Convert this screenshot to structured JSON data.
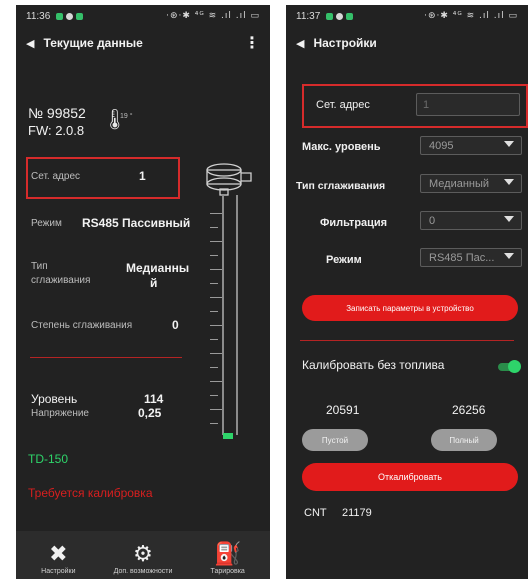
{
  "left": {
    "status": {
      "time": "11:36",
      "icons": "·⊛·✱ ⁴ᴳ ≋ .ıl .ıl ▭"
    },
    "appbar": {
      "title": "Текущие данные"
    },
    "device": {
      "number": "№ 99852",
      "fw": "FW: 2.0.8",
      "temp": "19 °"
    },
    "net_address": {
      "label": "Сет. адрес",
      "value": "1"
    },
    "mode": {
      "label": "Режим",
      "value": "RS485 Пассивный"
    },
    "smoothing_type": {
      "label_line1": "Тип",
      "label_line2": "сглаживания",
      "value_line1": "Медианны",
      "value_line2": "й"
    },
    "smoothing_degree": {
      "label": "Степень сглаживания",
      "value": "0"
    },
    "level": {
      "label": "Уровень",
      "value": "114"
    },
    "voltage": {
      "label": "Напряжение",
      "value": "0,25"
    },
    "model": "TD-150",
    "warning": "Требуется калибровка",
    "nav": [
      {
        "icon": "tools-icon",
        "label": "Настройки"
      },
      {
        "icon": "gear-icon",
        "label": "Доп. возможности"
      },
      {
        "icon": "fuel-can-icon",
        "label": "Тарировка"
      }
    ],
    "colors": {
      "background": "#222222",
      "accent_red": "#e11b1b",
      "green": "#2ed46a"
    }
  },
  "right": {
    "status": {
      "time": "11:37",
      "icons": "·⊛·✱ ⁴ᴳ ≋ .ıl .ıl ▭"
    },
    "appbar": {
      "title": "Настройки"
    },
    "net_address": {
      "label": "Сет. адрес",
      "value": "1"
    },
    "max_level": {
      "label": "Макс. уровень",
      "value": "4095"
    },
    "smoothing_type": {
      "label": "Тип сглаживания",
      "value": "Медианный"
    },
    "filtering": {
      "label": "Фильтрация",
      "value": "0"
    },
    "mode": {
      "label": "Режим",
      "value": "RS485 Пас..."
    },
    "write_button": "Записать параметры в устройство",
    "calibrate_no_fuel": {
      "label": "Калибровать без топлива",
      "enabled": true
    },
    "empty_value": "20591",
    "full_value": "26256",
    "empty_button": "Пустой",
    "full_button": "Полный",
    "calibrate_button": "Откалибровать",
    "cnt": {
      "label": "CNT",
      "value": "21179"
    }
  }
}
